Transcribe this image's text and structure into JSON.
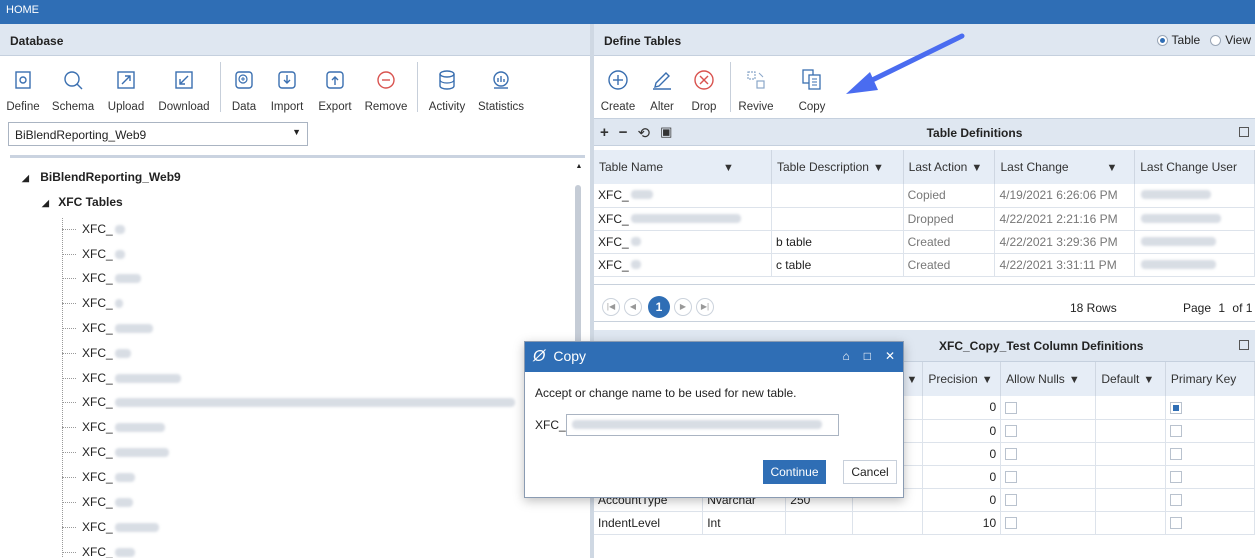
{
  "home": "HOME",
  "database": {
    "header": "Database",
    "toolbar": [
      {
        "label": "Define",
        "icon": "define-icon"
      },
      {
        "label": "Schema",
        "icon": "schema-icon"
      },
      {
        "label": "Upload",
        "icon": "upload-icon"
      },
      {
        "label": "Download",
        "icon": "download-icon"
      },
      {
        "label": "Data",
        "icon": "data-icon"
      },
      {
        "label": "Import",
        "icon": "import-icon"
      },
      {
        "label": "Export",
        "icon": "export-icon"
      },
      {
        "label": "Remove",
        "icon": "remove-icon"
      },
      {
        "label": "Activity",
        "icon": "activity-icon"
      },
      {
        "label": "Statistics",
        "icon": "statistics-icon"
      }
    ],
    "selected_db": "BiBlendReporting_Web9",
    "tree": {
      "root": "BiBlendReporting_Web9",
      "folder": "XFC Tables",
      "item_prefix": "XFC_"
    }
  },
  "define": {
    "header": "Define Tables",
    "radio": {
      "table": "Table",
      "view": "View"
    },
    "toolbar": [
      {
        "label": "Create",
        "icon": "plus-circle-icon"
      },
      {
        "label": "Alter",
        "icon": "pencil-icon"
      },
      {
        "label": "Drop",
        "icon": "x-circle-icon"
      },
      {
        "label": "Revive",
        "icon": "revive-icon"
      },
      {
        "label": "Copy",
        "icon": "copy-icon"
      }
    ],
    "table_defs": {
      "title": "Table Definitions",
      "columns": [
        "Table Name",
        "Table Description",
        "Last Action",
        "Last Change",
        "Last Change User"
      ],
      "rows": [
        {
          "name": "XFC_",
          "desc": "",
          "action": "Copied",
          "change": "4/19/2021 6:26:06 PM"
        },
        {
          "name": "XFC_",
          "desc": "",
          "action": "Dropped",
          "change": "4/22/2021 2:21:16 PM"
        },
        {
          "name": "XFC_",
          "desc": "b table",
          "action": "Created",
          "change": "4/22/2021 3:29:36 PM"
        },
        {
          "name": "XFC_",
          "desc": "c table",
          "action": "Created",
          "change": "4/22/2021 3:31:11 PM"
        }
      ],
      "rows_count": "18 Rows",
      "page": "Page",
      "page_num": "1",
      "of": "of 1",
      "current_page": "1"
    },
    "col_defs": {
      "title": "XFC_Copy_Test Column Definitions",
      "columns": [
        "Precision",
        "Allow Nulls",
        "Default",
        "Primary Key"
      ],
      "rows": [
        {
          "name": "",
          "type": "",
          "size": "",
          "precision": "0",
          "pk": true
        },
        {
          "name": "",
          "type": "",
          "size": "",
          "precision": "0",
          "pk": false
        },
        {
          "name": "",
          "type": "",
          "size": "",
          "precision": "0",
          "pk": false
        },
        {
          "name": "",
          "type": "",
          "size": "",
          "precision": "0",
          "pk": false
        },
        {
          "name": "AccountType",
          "type": "Nvarchar",
          "size": "250",
          "precision": "0",
          "pk": false
        },
        {
          "name": "IndentLevel",
          "type": "Int",
          "size": "",
          "precision": "10",
          "pk": false
        }
      ]
    }
  },
  "dialog": {
    "title": "Copy",
    "message": "Accept or change name to be used for new table.",
    "prefix": "XFC_",
    "continue": "Continue",
    "cancel": "Cancel"
  },
  "colors": {
    "accent": "#2f6eb5",
    "arrow": "#4a6cf0"
  }
}
